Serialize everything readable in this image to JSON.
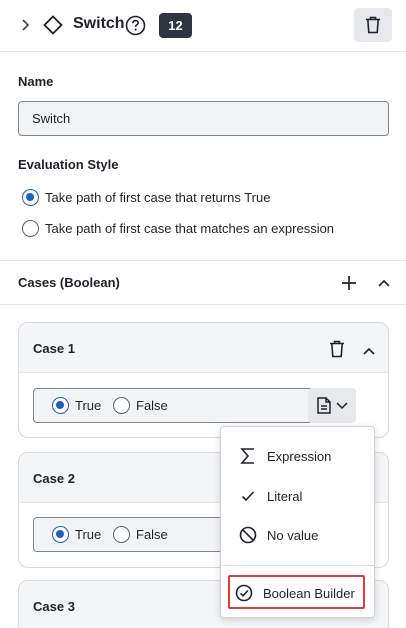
{
  "header": {
    "title": "Switch",
    "badge_count": "12",
    "icons": [
      "chevron-right-icon",
      "diamond-icon",
      "help-icon",
      "trash-icon"
    ]
  },
  "name_section": {
    "label": "Name",
    "value": "Switch"
  },
  "evaluation": {
    "label": "Evaluation Style",
    "options": [
      {
        "label": "Take path of first case that returns True",
        "selected": true
      },
      {
        "label": "Take path of first case that matches an expression",
        "selected": false
      }
    ]
  },
  "cases_section": {
    "title": "Cases (Boolean)",
    "cases": [
      {
        "title": "Case 1",
        "true_label": "True",
        "false_label": "False",
        "selected": "True"
      },
      {
        "title": "Case 2",
        "true_label": "True",
        "false_label": "False",
        "selected": "True"
      },
      {
        "title": "Case 3"
      }
    ]
  },
  "menu": {
    "items": [
      {
        "label": "Expression",
        "icon": "sigma-icon"
      },
      {
        "label": "Literal",
        "icon": "check-icon"
      },
      {
        "label": "No value",
        "icon": "no-value-icon"
      },
      {
        "label": "Boolean Builder",
        "icon": "check-circle-icon",
        "highlighted": true
      }
    ]
  },
  "colors": {
    "accent": "#1e5fc4",
    "badge_bg": "#2e3440",
    "highlight_border": "#e53935"
  }
}
